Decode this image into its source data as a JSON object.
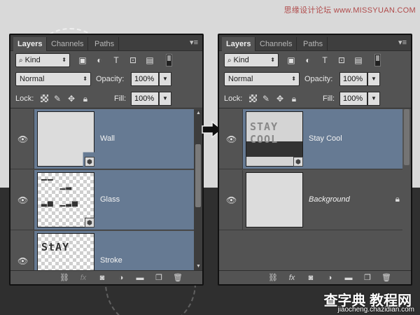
{
  "watermark": {
    "top_text": "思缘设计论坛 www.MISSYUAN.COM",
    "logo": "查字典 教程网",
    "url": "jiaocheng.chazidian.com"
  },
  "tabs": [
    "Layers",
    "Channels",
    "Paths"
  ],
  "filter": {
    "kind_label": "Kind"
  },
  "blend": {
    "mode": "Normal",
    "opacity_label": "Opacity:",
    "opacity_value": "100%",
    "lock_label": "Lock:",
    "fill_label": "Fill:",
    "fill_value": "100%"
  },
  "left_panel": {
    "layers": [
      {
        "name": "Wall",
        "selected": true,
        "thumb": "wall"
      },
      {
        "name": "Glass",
        "selected": true,
        "thumb": "glass"
      },
      {
        "name": "Stroke",
        "selected": true,
        "thumb": "stroke"
      }
    ]
  },
  "right_panel": {
    "layers": [
      {
        "name": "Stay Cool",
        "selected": true,
        "thumb": "stay"
      },
      {
        "name": "Background",
        "selected": false,
        "thumb": "bg",
        "locked": true
      }
    ]
  },
  "thumb_text": {
    "stay_cool_scribble": "STAY\nCOOL",
    "stroke_scribble": "StAY"
  },
  "colors": {
    "selection": "#667a93",
    "panel": "#535353",
    "tabbar": "#3e3e3e"
  }
}
